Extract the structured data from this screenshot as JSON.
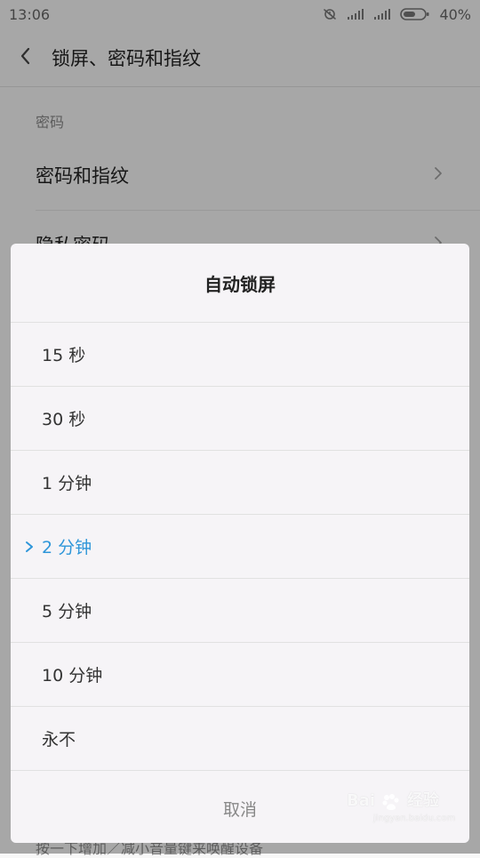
{
  "status_bar": {
    "time": "13:06",
    "battery": "40%"
  },
  "header": {
    "title": "锁屏、密码和指纹"
  },
  "background": {
    "section_title": "密码",
    "rows": [
      {
        "label": "密码和指纹"
      },
      {
        "label": "隐私密码"
      }
    ],
    "bottom_hint": "按一下增加／减小音量键来唤醒设备"
  },
  "dialog": {
    "title": "自动锁屏",
    "options": [
      {
        "label": "15 秒",
        "selected": false
      },
      {
        "label": "30 秒",
        "selected": false
      },
      {
        "label": "1 分钟",
        "selected": false
      },
      {
        "label": "2 分钟",
        "selected": true
      },
      {
        "label": "5 分钟",
        "selected": false
      },
      {
        "label": "10 分钟",
        "selected": false
      },
      {
        "label": "永不",
        "selected": false
      }
    ],
    "cancel": "取消"
  },
  "watermark": {
    "brand": "Bai",
    "product": "经验",
    "domain": "jingyan.baidu.com"
  },
  "colors": {
    "accent": "#2e96d9",
    "overlay": "#000000",
    "dialog_bg": "#f6f4f7"
  },
  "icons": {
    "back": "chevron-left-icon",
    "row_chevron": "chevron-right-icon",
    "selected": "chevron-right-icon",
    "status_alarm": "alarm-off-icon",
    "status_signal": "signal-icon",
    "status_battery": "battery-icon"
  }
}
